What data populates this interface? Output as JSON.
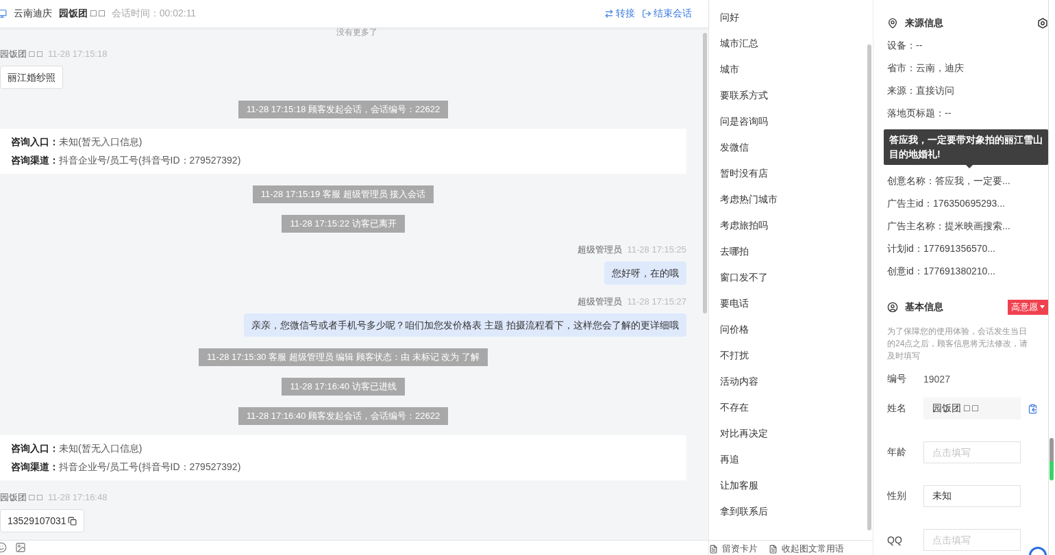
{
  "header": {
    "location": "云南迪庆",
    "customer": "园饭团 □ □",
    "session_time": "会话时间：00:02:11",
    "actions": [
      {
        "kind": "transfer",
        "label": "转接"
      },
      {
        "kind": "end",
        "label": "结束会话"
      }
    ]
  },
  "chat": {
    "top_note": "没有更多了",
    "messages": [
      {
        "kind": "customer",
        "name": "园饭团 □ □",
        "time": "11-28 17:15:18",
        "text": "丽江婚纱照",
        "copyable": false
      },
      {
        "kind": "system",
        "text": "11-28 17:15:18 顾客发起会话，会话编号：22622"
      },
      {
        "kind": "info",
        "rows": [
          "**咨询入口：**未知(暂无入口信息)",
          "**咨询渠道：**抖音企业号/员工号(抖音号ID：279527392)"
        ]
      },
      {
        "kind": "system",
        "text": "11-28 17:15:19 客服 超级管理员 接入会话"
      },
      {
        "kind": "system",
        "text": "11-28 17:15:22 访客已离开"
      },
      {
        "kind": "agent",
        "name": "超级管理员",
        "time": "11-28 17:15:25",
        "text": "您好呀，在的哦"
      },
      {
        "kind": "agent",
        "name": "超级管理员",
        "time": "11-28 17:15:27",
        "text": "亲亲，您微信号或者手机号多少呢？咱们加您发价格表 主题 拍摄流程看下，这样您会了解的更详细哦"
      },
      {
        "kind": "system",
        "text": "11-28 17:15:30 客服 超级管理员 编辑 顾客状态：由 未标记 改为 了解"
      },
      {
        "kind": "system",
        "text": "11-28 17:16:40 访客已进线"
      },
      {
        "kind": "system",
        "text": "11-28 17:16:40 顾客发起会话，会话编号：22622"
      },
      {
        "kind": "info",
        "rows": [
          "**咨询入口：**未知(暂无入口信息)",
          "**咨询渠道：**抖音企业号/员工号(抖音号ID：279527392)"
        ]
      },
      {
        "kind": "customer",
        "name": "园饭团 □ □",
        "time": "11-28 17:16:48",
        "text": "13529107031",
        "copyable": true
      }
    ]
  },
  "quick_replies": {
    "items": [
      "问好",
      "城市汇总",
      "城市",
      "要联系方式",
      "问是咨询吗",
      "发微信",
      "暂时没有店",
      "考虑热门城市",
      "考虑旅拍吗",
      "去哪拍",
      "窗口发不了",
      "要电话",
      "问价格",
      "不打扰",
      "活动内容",
      "不存在",
      "对比再决定",
      "再追",
      "让加客服",
      "拿到联系后"
    ],
    "footer": [
      "留资卡片",
      "收起图文常用语"
    ]
  },
  "source_info": {
    "title": "来源信息",
    "rows_above": [
      "设备：--",
      "省市：云南，迪庆",
      "来源：直接访问",
      "落地页标题：--"
    ],
    "tooltip": "答应我，一定要带对象拍的丽江雪山目的地婚礼!",
    "rows_below": [
      "创意名称：答应我，一定要...",
      "广告主id：176350695293...",
      "广告主名称：提米映画搜索...",
      "计划id：177691356570...",
      "创意id：177691380210..."
    ]
  },
  "basic_info": {
    "title": "基本信息",
    "intent": "高意愿",
    "notice": "为了保障您的使用体验，会话发生当日的24点之后，顾客信息将无法修改，请及时填写",
    "fields": [
      {
        "kind": "text",
        "label": "编号",
        "value": "19027"
      },
      {
        "kind": "readonly",
        "label": "姓名",
        "value": "园饭团 □ □"
      },
      {
        "kind": "input",
        "label": "年龄",
        "placeholder": "点击填写"
      },
      {
        "kind": "input",
        "label": "性别",
        "value": "未知"
      },
      {
        "kind": "input",
        "label": "QQ",
        "placeholder": "点击填写"
      }
    ]
  }
}
